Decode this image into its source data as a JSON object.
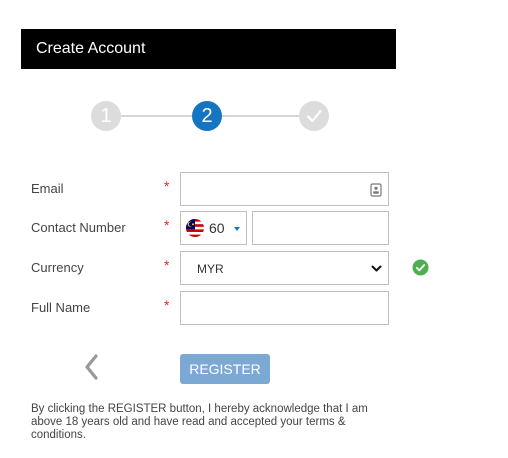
{
  "header": {
    "title": "Create Account"
  },
  "stepper": {
    "steps": [
      {
        "label": "1",
        "state": "done"
      },
      {
        "label": "2",
        "state": "active"
      },
      {
        "label": "",
        "state": "pending",
        "icon": "check-icon"
      }
    ]
  },
  "form": {
    "email": {
      "label": "Email",
      "required_mark": "*",
      "value": "",
      "icon": "id-card-icon"
    },
    "contact": {
      "label": "Contact Number",
      "required_mark": "*",
      "country_code": "60",
      "flag": "malaysia-flag-icon",
      "value": ""
    },
    "currency": {
      "label": "Currency",
      "required_mark": "*",
      "selected": "MYR",
      "status_icon": "check-circle-icon"
    },
    "full_name": {
      "label": "Full Name",
      "required_mark": "*",
      "value": ""
    }
  },
  "actions": {
    "back_icon": "chevron-left-icon",
    "register_label": "REGISTER"
  },
  "disclaimer": "By clicking the REGISTER button, I hereby acknowledge that I am above 18 years old and have read and accepted your terms & conditions.",
  "colors": {
    "accent": "#1475c3",
    "header_bg": "#000000",
    "required": "#e3262a",
    "success": "#4caf50",
    "button": "#7ba9d3"
  }
}
